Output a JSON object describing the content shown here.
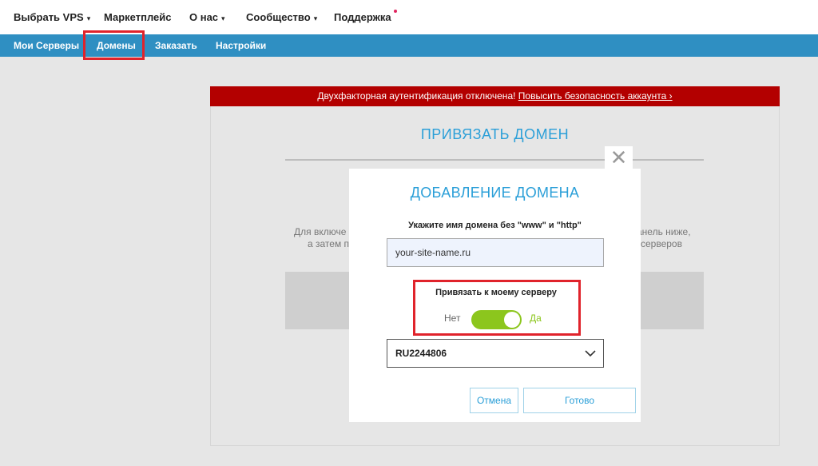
{
  "topnav": {
    "items": [
      {
        "label": "Выбрать VPS",
        "caret": "▾"
      },
      {
        "label": "Маркетплейс"
      },
      {
        "label": "О нас",
        "caret": "▾"
      },
      {
        "label": "Сообщество",
        "caret": "▾"
      },
      {
        "label": "Поддержка"
      }
    ]
  },
  "subnav": {
    "items": [
      {
        "label": "Мои Серверы"
      },
      {
        "label": "Домены"
      },
      {
        "label": "Заказать"
      },
      {
        "label": "Настройки"
      }
    ]
  },
  "alert": {
    "text": "Двухфакторная аутентификация отключена!",
    "link": "Повысить безопасность аккаунта ›"
  },
  "background": {
    "title": "ПРИВЯЗАТЬ ДОМЕН",
    "text_left_1": "Для включе",
    "text_left_2": "а затем п",
    "text_right_1": "анель ниже,",
    "text_right_2": "серверов"
  },
  "modal": {
    "close_symbol": "✕",
    "title": "ДОБАВЛЕНИЕ ДОМЕНА",
    "domain_label": "Укажите имя домена без \"www\" и \"http\"",
    "domain_value": "your-site-name.ru",
    "bind_label": "Привязать к моему серверу",
    "toggle_off_label": "Нет",
    "toggle_on_label": "Да",
    "toggle_state": "on",
    "server_value": "RU2244806",
    "cancel_label": "Отмена",
    "done_label": "Готово"
  },
  "colors": {
    "accent": "#2b9fd8",
    "subnav": "#2f8fc2",
    "alert": "#b30000",
    "toggle": "#8cc61d",
    "highlight": "#e0232b"
  }
}
